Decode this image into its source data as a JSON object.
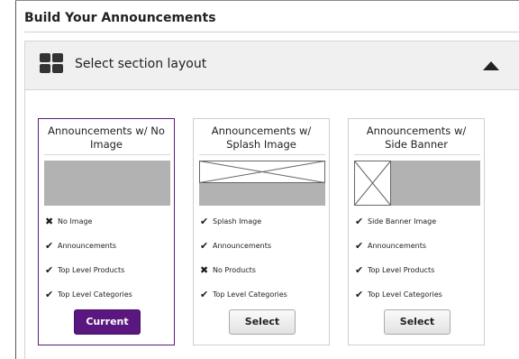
{
  "page_title": "Build Your Announcements",
  "section": {
    "title": "Select section layout",
    "icon": "grid-layout-icon",
    "collapse_icon": "chevron-up-icon"
  },
  "cards": [
    {
      "title_line1": "Announcements w/ No",
      "title_line2": "Image",
      "thumbnail": "gray-banner",
      "features": [
        {
          "icon": "x-icon",
          "text": "No Image"
        },
        {
          "icon": "check-icon",
          "text": "Announcements"
        },
        {
          "icon": "check-icon",
          "text": "Top Level Products"
        },
        {
          "icon": "check-icon",
          "text": "Top Level Categories"
        }
      ],
      "button_label": "Current",
      "state": "current"
    },
    {
      "title_line1": "Announcements w/",
      "title_line2": "Splash Image",
      "thumbnail": "splash-image-placeholder",
      "features": [
        {
          "icon": "check-icon",
          "text": "Splash Image"
        },
        {
          "icon": "check-icon",
          "text": "Announcements"
        },
        {
          "icon": "x-icon",
          "text": "No Products"
        },
        {
          "icon": "check-icon",
          "text": "Top Level Categories"
        }
      ],
      "button_label": "Select",
      "state": "available"
    },
    {
      "title_line1": "Announcements w/",
      "title_line2": "Side Banner",
      "thumbnail": "side-banner-placeholder",
      "features": [
        {
          "icon": "check-icon",
          "text": "Side Banner Image"
        },
        {
          "icon": "check-icon",
          "text": "Announcements"
        },
        {
          "icon": "check-icon",
          "text": "Top Level Products"
        },
        {
          "icon": "check-icon",
          "text": "Top Level Categories"
        }
      ],
      "button_label": "Select",
      "state": "available"
    }
  ],
  "colors": {
    "accent": "#5a1780",
    "placeholder_gray": "#b2b2b2",
    "header_bg": "#f0f0f0"
  }
}
